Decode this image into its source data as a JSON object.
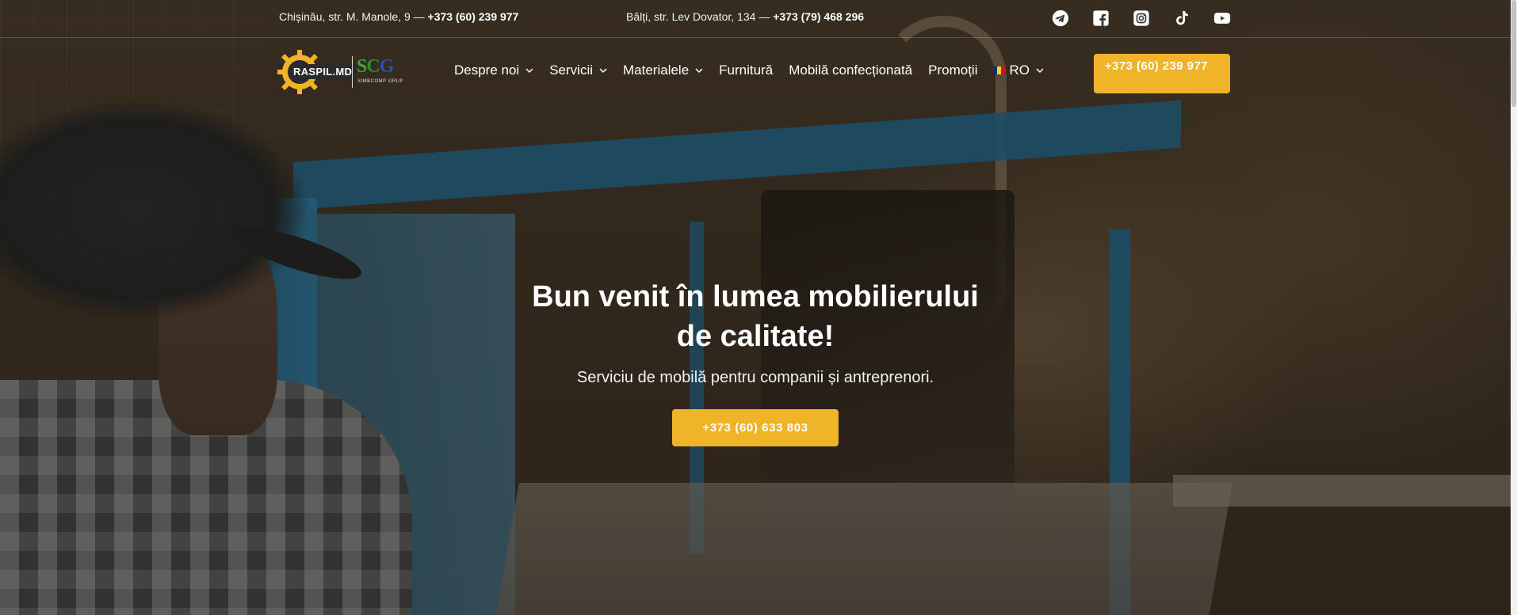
{
  "topbar": {
    "contact1_text": "Chișinău, str. M. Manole, 9 — ",
    "contact1_phone": "+373 (60) 239 977",
    "contact2_text": "Bălți, str. Lev Dovator, 134  — ",
    "contact2_phone": "+373 (79) 468 296",
    "socials": [
      "telegram-icon",
      "facebook-icon",
      "instagram-icon",
      "tiktok-icon",
      "youtube-icon"
    ]
  },
  "logo": {
    "brand": "RASPIL.MD",
    "partner": "SCG",
    "partner_sub": "SIMBCOMP GRUP"
  },
  "nav": {
    "items": [
      {
        "label": "Despre noi",
        "has_dropdown": true
      },
      {
        "label": "Servicii",
        "has_dropdown": true
      },
      {
        "label": "Materialele",
        "has_dropdown": true
      },
      {
        "label": "Furnitură",
        "has_dropdown": false
      },
      {
        "label": "Mobilă confecționată",
        "has_dropdown": false
      },
      {
        "label": "Promoții",
        "has_dropdown": false
      }
    ],
    "language": "RO",
    "cta_phone": "+373 (60) 239 977"
  },
  "hero": {
    "title": "Bun venit în lumea mobilierului de calitate!",
    "subtitle": "Serviciu de mobilă pentru companii și antreprenori.",
    "button_label": "+373 (60) 633 803"
  },
  "colors": {
    "accent": "#f0b429",
    "text": "#ffffff",
    "flag_blue": "#002b7f",
    "flag_yellow": "#fcd116",
    "flag_red": "#ce1126"
  }
}
